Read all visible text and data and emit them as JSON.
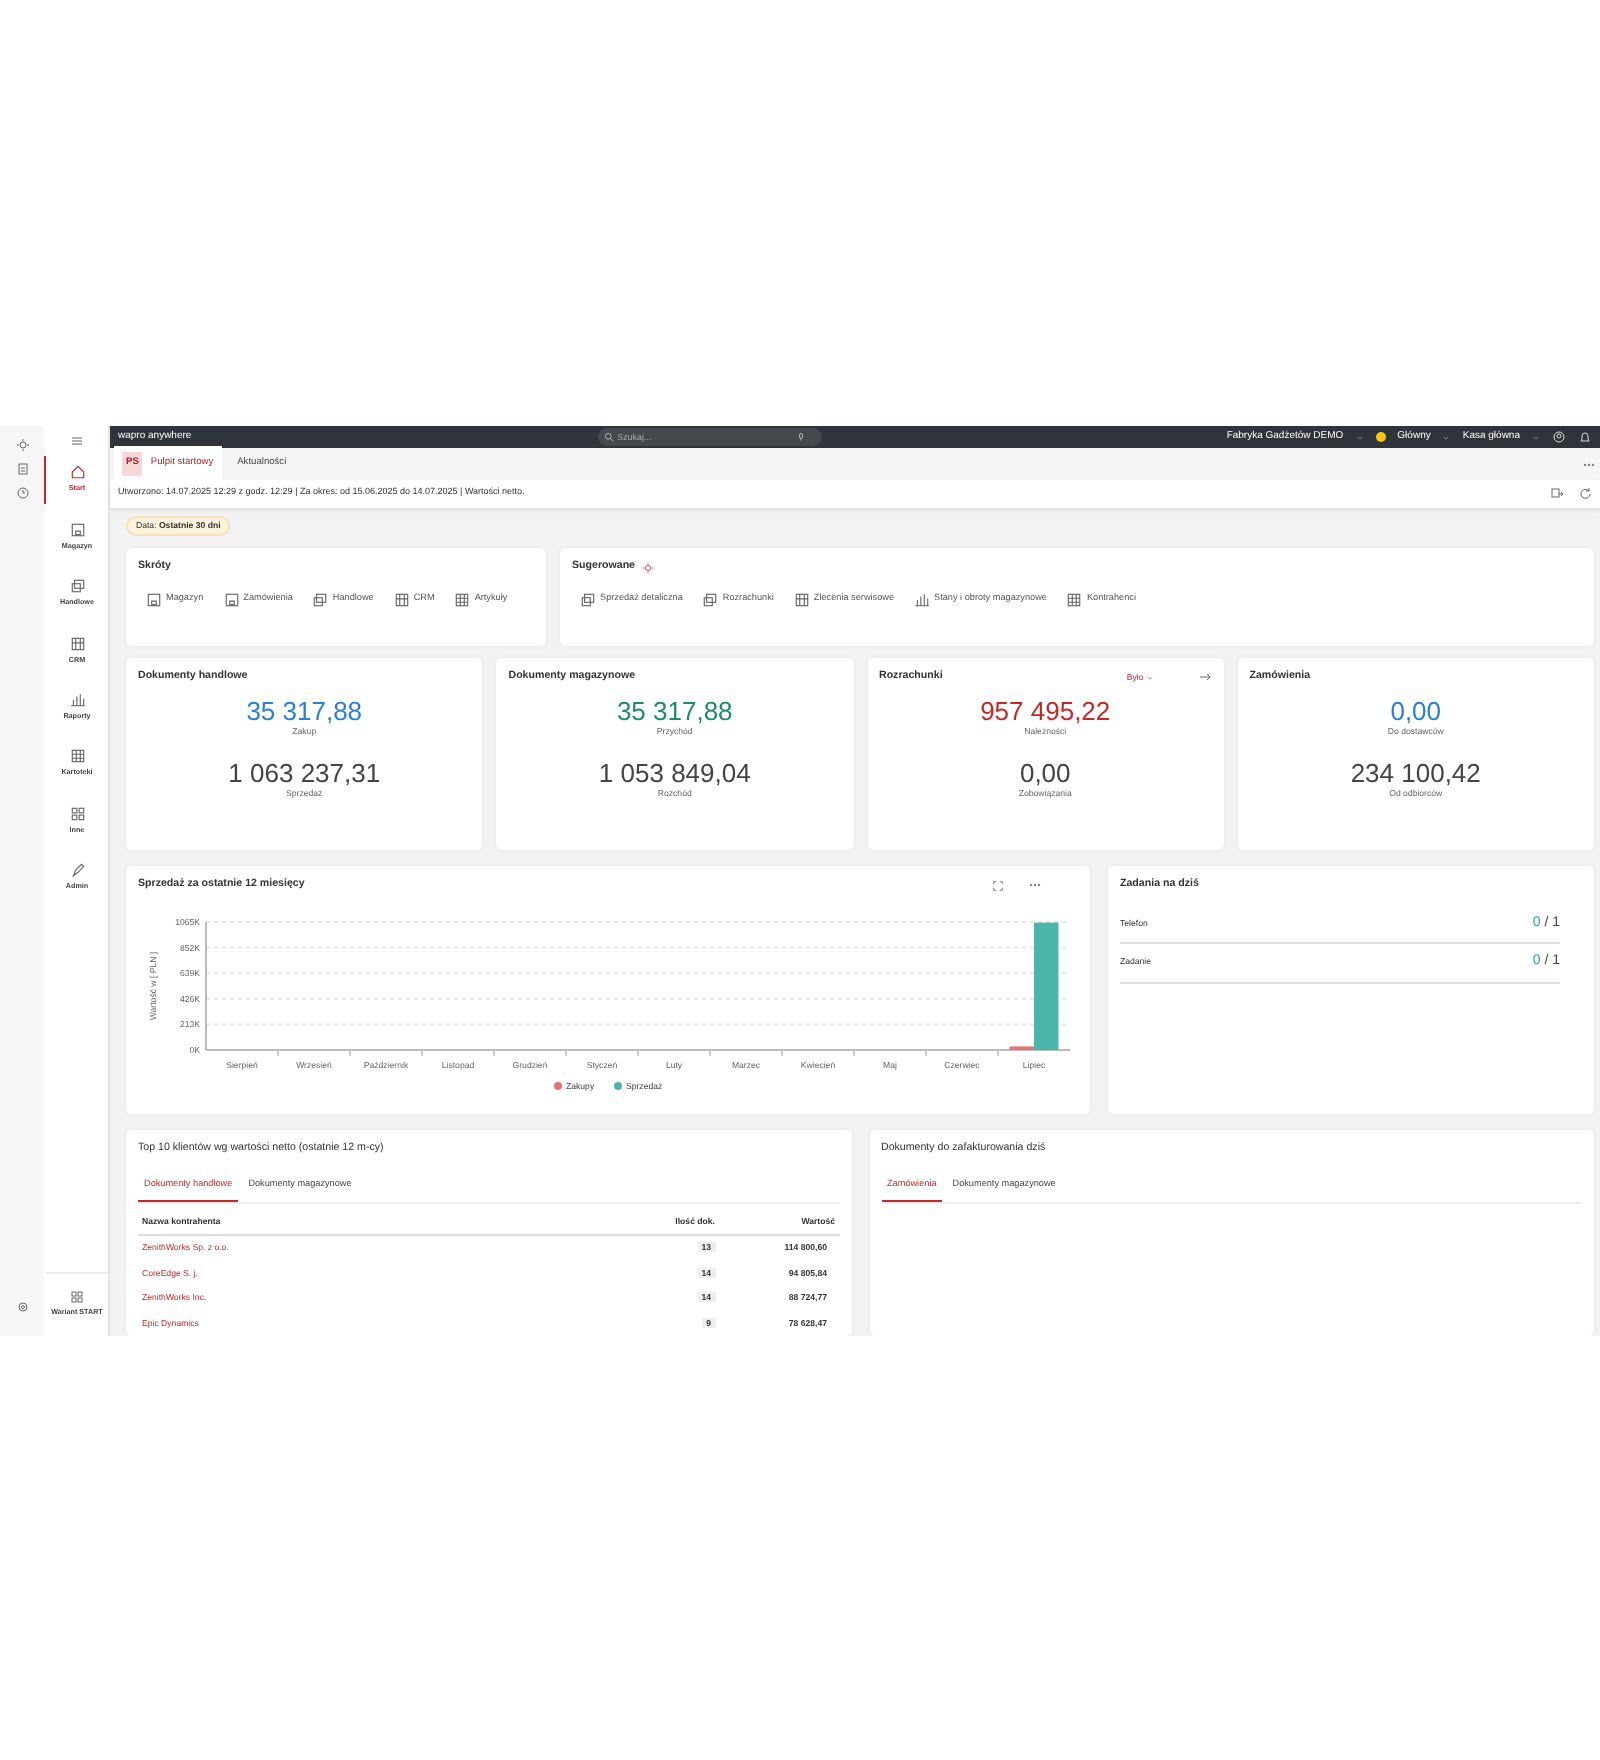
{
  "brand": "wapro anywhere",
  "search": {
    "placeholder": "Szukaj..."
  },
  "topbar": {
    "company": "Fabryka Gadżetów DEMO",
    "user": "Główny",
    "register": "Kasa główna"
  },
  "sidebar": {
    "items": [
      {
        "label": "Start",
        "kind": "home",
        "selected": true
      },
      {
        "label": "Magazyn",
        "kind": "box",
        "selected": false
      },
      {
        "label": "Handlowe",
        "kind": "docs",
        "selected": false
      },
      {
        "label": "CRM",
        "kind": "building",
        "selected": false
      },
      {
        "label": "Raporty",
        "kind": "chart",
        "selected": false
      },
      {
        "label": "Kartoteki",
        "kind": "grid",
        "selected": false
      },
      {
        "label": "Inne",
        "kind": "squares",
        "selected": false
      },
      {
        "label": "Admin",
        "kind": "pen",
        "selected": false
      }
    ],
    "footer": "Wariant START"
  },
  "tabs": [
    {
      "badge": "PS",
      "label": "Pulpit startowy",
      "selected": true
    },
    {
      "label": "Aktualności",
      "selected": false
    }
  ],
  "info": "Utworzono: 14.07.2025 12:29 z godz. 12:29 | Za okres: od 15.06.2025 do 14.07.2025 | Wartości netto.",
  "filter": {
    "label": "Data:",
    "value": "Ostatnie 30 dni"
  },
  "shortcuts": {
    "title": "Skróty",
    "items": [
      {
        "label": "Magazyn",
        "kind": "box"
      },
      {
        "label": "Zamówienia",
        "kind": "box"
      },
      {
        "label": "Handlowe",
        "kind": "docs"
      },
      {
        "label": "CRM",
        "kind": "building"
      },
      {
        "label": "Artykuły",
        "kind": "grid"
      }
    ]
  },
  "suggested": {
    "title": "Sugerowane",
    "items": [
      {
        "label": "Sprzedaż detaliczna",
        "kind": "docs"
      },
      {
        "label": "Rozrachunki",
        "kind": "docs"
      },
      {
        "label": "Zlecenia serwisowe",
        "kind": "building"
      },
      {
        "label": "Stany i obroty magazynowe",
        "kind": "chart"
      },
      {
        "label": "Kontrahenci",
        "kind": "grid"
      }
    ]
  },
  "summary_cards": [
    {
      "title": "Dokumenty handlowe",
      "primary": {
        "value": "35 317,88",
        "label": "Zakup",
        "color": "#2b7fd4"
      },
      "secondary": {
        "value": "1 063 237,31",
        "label": "Sprzedaż"
      }
    },
    {
      "title": "Dokumenty magazynowe",
      "primary": {
        "value": "35 317,88",
        "label": "Przychód",
        "color": "#1f8a70"
      },
      "secondary": {
        "value": "1 053 849,04",
        "label": "Rozchód"
      }
    },
    {
      "title": "Rozrachunki",
      "dropdown": "Było",
      "has_arrow": true,
      "primary": {
        "value": "957 495,22",
        "label": "Należności",
        "color": "#c62828"
      },
      "secondary": {
        "value": "0,00",
        "label": "Zobowiązania"
      }
    },
    {
      "title": "Zamówienia",
      "primary": {
        "value": "0,00",
        "label": "Do dostawców",
        "color": "#2b7fd4"
      },
      "secondary": {
        "value": "234 100,42",
        "label": "Od odbiorców"
      }
    }
  ],
  "sales_chart": {
    "title": "Sprzedaż za ostatnie 12 miesięcy",
    "chart_data": {
      "type": "bar",
      "ylabel": "Wartość w [ PLN ]",
      "categories": [
        "Sierpień",
        "Wrzesień",
        "Październik",
        "Listopad",
        "Grudzień",
        "Styczeń",
        "Luty",
        "Marzec",
        "Kwiecień",
        "Maj",
        "Czerwiec",
        "Lipiec"
      ],
      "series": [
        {
          "name": "Zakupy",
          "color": "#e57373",
          "values": [
            0,
            0,
            0,
            0,
            0,
            0,
            0,
            0,
            0,
            0,
            0,
            30000
          ]
        },
        {
          "name": "Sprzedaż",
          "color": "#4db6ac",
          "values": [
            0,
            0,
            0,
            0,
            0,
            0,
            0,
            0,
            0,
            0,
            0,
            1060000
          ]
        }
      ],
      "grid": true,
      "legend": true,
      "ylim": [
        0,
        1065000
      ],
      "yticks": [
        {
          "value": 0,
          "label": "0K"
        },
        {
          "value": 213000,
          "label": "213K"
        },
        {
          "value": 426000,
          "label": "426K"
        },
        {
          "value": 639000,
          "label": "639K"
        },
        {
          "value": 852000,
          "label": "852K"
        },
        {
          "value": 1065000,
          "label": "1065K"
        }
      ]
    }
  },
  "tasks": {
    "title": "Zadania na dziś",
    "rows": [
      {
        "label": "Telefon",
        "done": "0",
        "of": "/ 1"
      },
      {
        "label": "Zadanie",
        "done": "0",
        "of": "/ 1"
      }
    ]
  },
  "top_clients": {
    "title": "Top 10 klientów wg wartości netto (ostatnie 12 m-cy)",
    "tabs": [
      {
        "label": "Dokumenty handlowe",
        "selected": true
      },
      {
        "label": "Dokumenty magazynowe",
        "selected": false
      }
    ],
    "columns": [
      "Nazwa kontrahenta",
      "Ilość dok.",
      "Wartość"
    ],
    "rows": [
      [
        "ZenithWorks Sp. z o.o.",
        "13",
        "114 800,60"
      ],
      [
        "CoreEdge S. j.",
        "14",
        "94 805,84"
      ],
      [
        "ZenithWorks Inc.",
        "14",
        "88 724,77"
      ],
      [
        "Epic Dynamics",
        "9",
        "78 628,47"
      ]
    ]
  },
  "billing": {
    "title": "Dokumenty do zafakturowania dziś",
    "tabs": [
      {
        "label": "Zamówienia",
        "selected": true
      },
      {
        "label": "Dokumenty magazynowe",
        "selected": false
      }
    ]
  }
}
